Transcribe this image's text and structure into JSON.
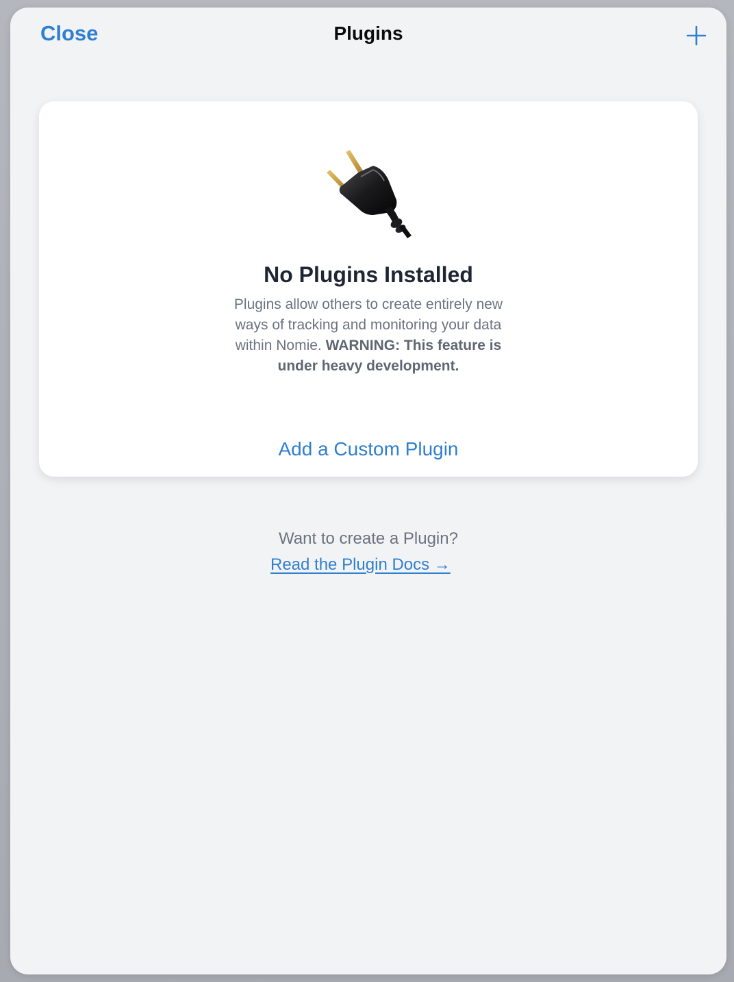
{
  "nav": {
    "close_label": "Close",
    "title": "Plugins",
    "add_icon": "plus-icon"
  },
  "empty_state": {
    "icon": "electric-plug-icon",
    "title": "No Plugins Installed",
    "description": "Plugins allow others to create entirely new ways of tracking and monitoring your data within Nomie.",
    "warning": "WARNING: This feature is under heavy development.",
    "add_custom_label": "Add a Custom Plugin"
  },
  "footer": {
    "question": "Want to create a Plugin?",
    "docs_link": "Read the Plugin Docs →"
  },
  "colors": {
    "accent": "#2f7fd0",
    "background": "#f2f3f5",
    "card": "#ffffff",
    "title": "#1f2633",
    "muted": "#6b7280"
  }
}
